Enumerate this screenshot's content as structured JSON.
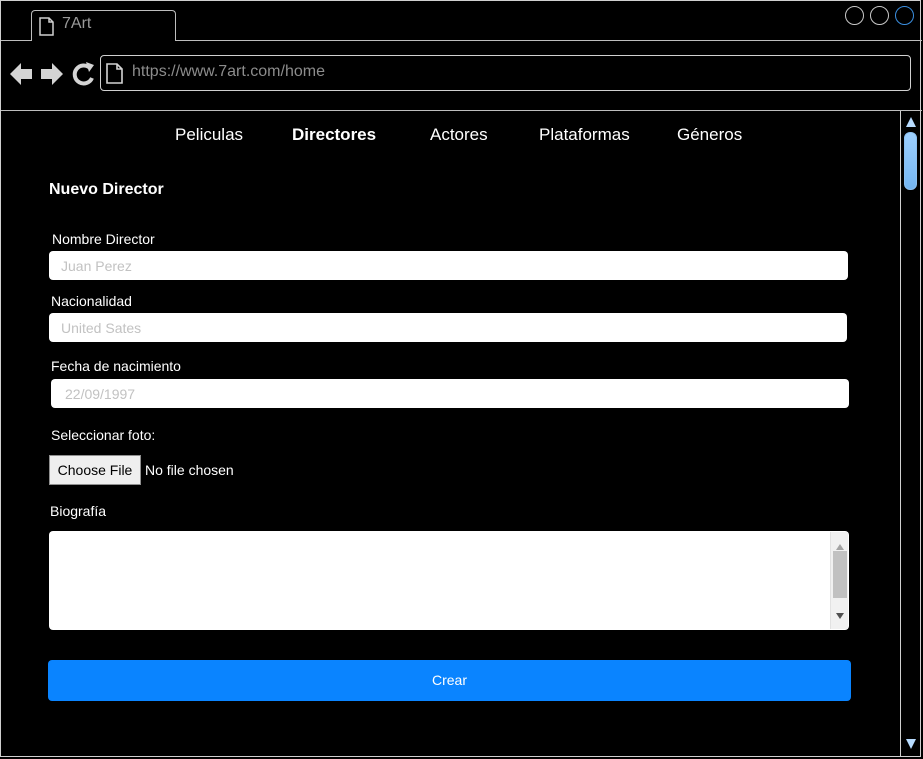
{
  "browser": {
    "tab_title": "7Art",
    "url": "https://www.7art.com/home"
  },
  "nav": {
    "items": [
      "Peliculas",
      "Directores",
      "Actores",
      "Plataformas",
      "Géneros"
    ],
    "active": "Directores"
  },
  "form": {
    "title": "Nuevo Director",
    "name_label": "Nombre Director",
    "name_placeholder": "Juan Perez",
    "nationality_label": "Nacionalidad",
    "nationality_placeholder": "United Sates",
    "birthdate_label": "Fecha de nacimiento",
    "birthdate_placeholder": "22/09/1997",
    "photo_label": "Seleccionar foto:",
    "file_button": "Choose File",
    "file_status": "No file chosen",
    "bio_label": "Biografía",
    "submit": "Crear"
  },
  "colors": {
    "primary_button": "#0a84ff",
    "background": "#000000"
  }
}
